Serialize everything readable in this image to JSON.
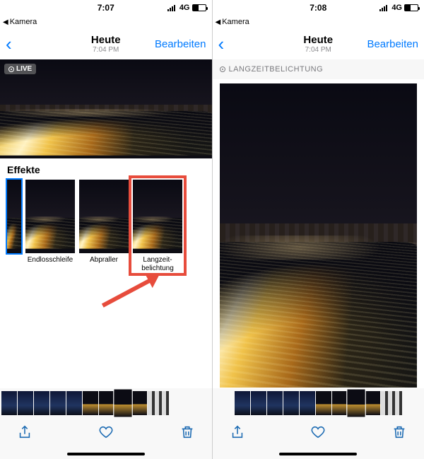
{
  "left": {
    "status": {
      "time": "7:07",
      "net": "4G"
    },
    "back_label": "Kamera",
    "nav": {
      "title": "Heute",
      "subtitle": "7:04 PM",
      "edit": "Bearbeiten"
    },
    "live_badge": "LIVE",
    "effects_heading": "Effekte",
    "effects": [
      {
        "label": "Endlosschleife"
      },
      {
        "label": "Abpraller"
      },
      {
        "label": "Langzeit-\nbelichtung"
      }
    ]
  },
  "right": {
    "status": {
      "time": "7:08",
      "net": "4G"
    },
    "back_label": "Kamera",
    "nav": {
      "title": "Heute",
      "subtitle": "7:04 PM",
      "edit": "Bearbeiten"
    },
    "mode_label": "LANGZEITBELICHTUNG"
  }
}
